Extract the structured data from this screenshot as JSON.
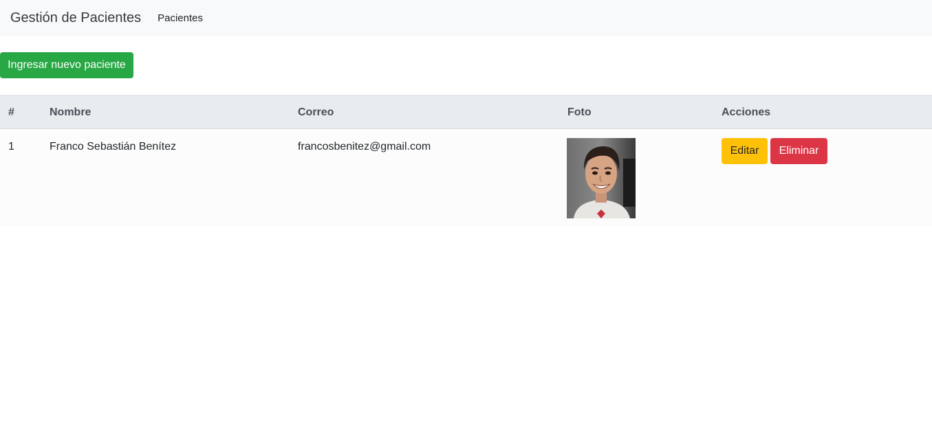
{
  "navbar": {
    "brand": "Gestión de Pacientes",
    "link_pacientes": "Pacientes"
  },
  "actions": {
    "new_patient_label": "Ingresar nuevo paciente"
  },
  "table": {
    "headers": [
      "#",
      "Nombre",
      "Correo",
      "Foto",
      "Acciones"
    ],
    "rows": [
      {
        "id": "1",
        "nombre": "Franco Sebastián Benítez",
        "correo": "francosbenitez@gmail.com",
        "foto": "patient-photo",
        "edit_label": "Editar",
        "delete_label": "Eliminar"
      }
    ]
  },
  "colors": {
    "success": "#28a745",
    "warning": "#ffc107",
    "danger": "#dc3545",
    "navbar_bg": "#f8f9fa",
    "thead_bg": "#e9ecef"
  }
}
